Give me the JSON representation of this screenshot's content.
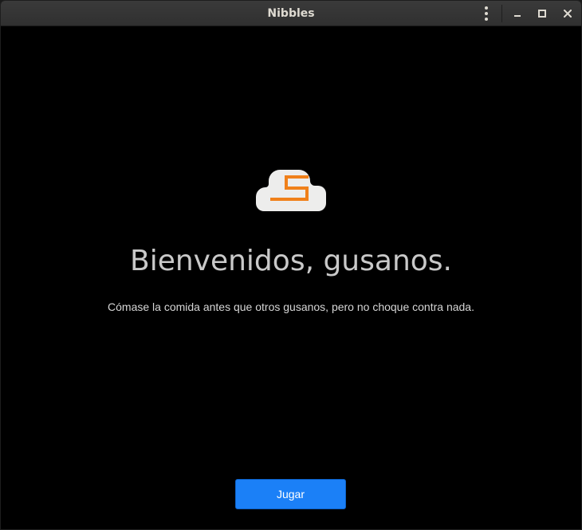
{
  "window": {
    "title": "Nibbles"
  },
  "titlebar": {
    "menu_icon": "vertical-ellipsis-icon",
    "minimize_icon": "minimize-icon",
    "maximize_icon": "maximize-icon",
    "close_icon": "close-icon",
    "close_glyph": "×"
  },
  "welcome": {
    "logo_icon": "nibbles-cloud-logo-icon",
    "headline": "Bienvenidos, gusanos.",
    "subtitle": "Cómase la comida antes que otros gusanos, pero no choque contra nada.",
    "play_label": "Jugar"
  },
  "colors": {
    "accent": "#1b80f7",
    "logo_orange": "#f0801a",
    "logo_cloud": "#ededec",
    "background": "#000000"
  }
}
